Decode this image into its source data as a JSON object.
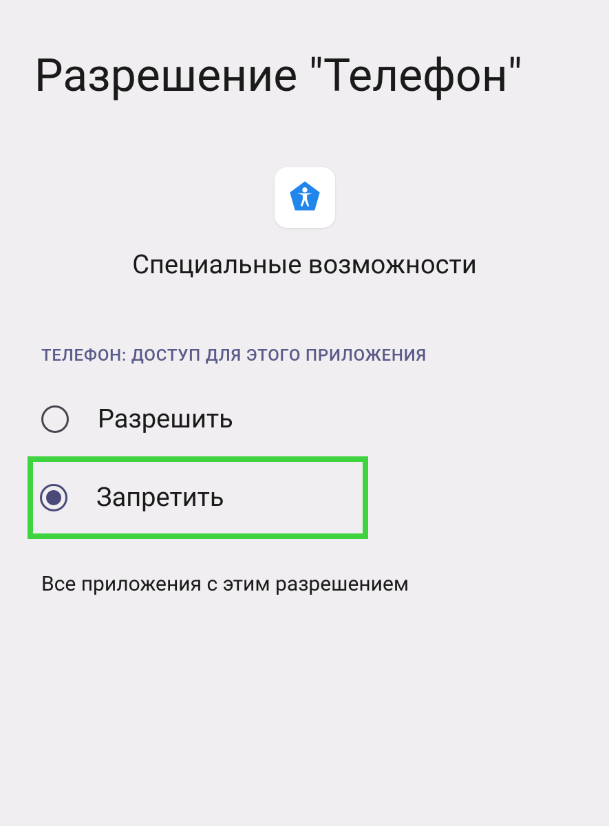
{
  "title": "Разрешение \"Телефон\"",
  "app": {
    "name": "Специальные возможности",
    "icon_color": "#2186eb"
  },
  "section": {
    "header": "ТЕЛЕФОН: ДОСТУП ДЛЯ ЭТОГО ПРИЛОЖЕНИЯ"
  },
  "options": {
    "allow": {
      "label": "Разрешить",
      "selected": false
    },
    "deny": {
      "label": "Запретить",
      "selected": true
    }
  },
  "footer": {
    "all_apps_link": "Все приложения с этим разрешением"
  }
}
